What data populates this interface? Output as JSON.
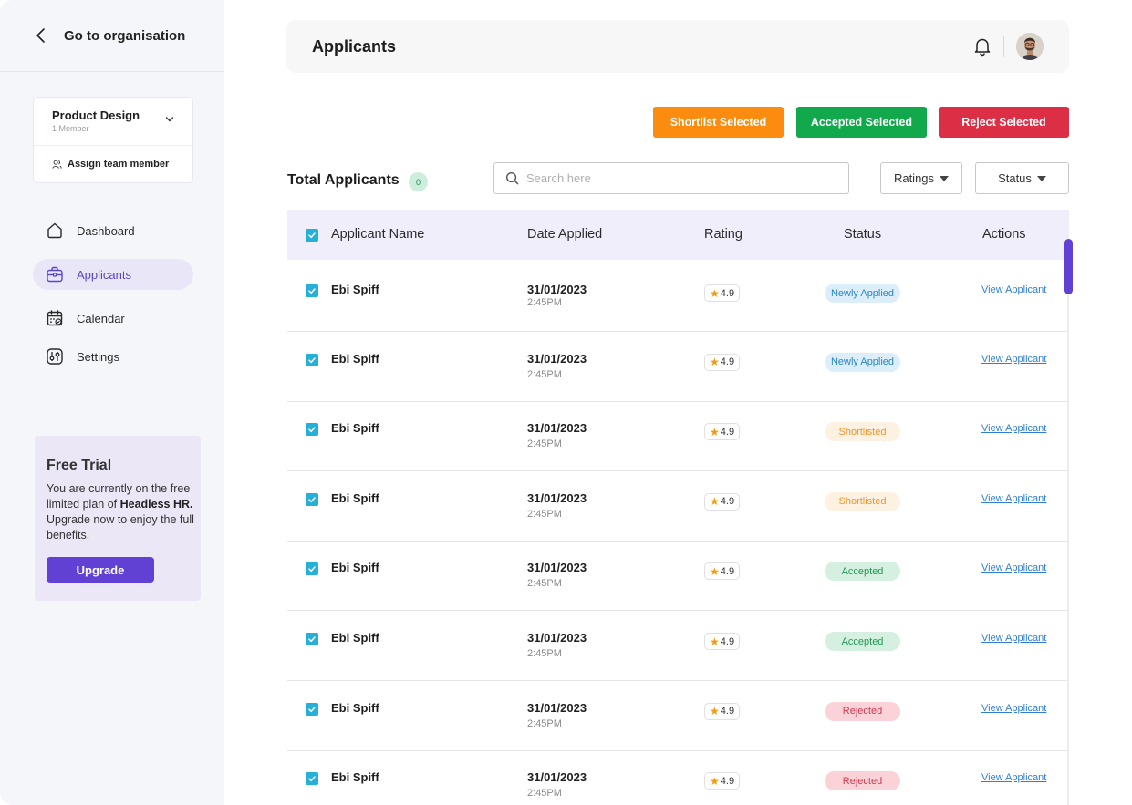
{
  "sidebar": {
    "back_label": "Go to organisation",
    "team": {
      "name": "Product Design",
      "members": "1 Member",
      "assign_label": "Assign team member"
    },
    "nav": [
      {
        "label": "Dashboard",
        "icon": "home-icon",
        "active": false
      },
      {
        "label": "Applicants",
        "icon": "briefcase-icon",
        "active": true
      },
      {
        "label": "Calendar",
        "icon": "calendar-icon",
        "active": false
      },
      {
        "label": "Settings",
        "icon": "settings-icon",
        "active": false
      }
    ],
    "trial": {
      "title": "Free Trial",
      "text_before": "You are currently on the free limited plan of ",
      "brand": "Headless HR.",
      "text_after": " Upgrade now to enjoy the full benefits.",
      "button": "Upgrade"
    }
  },
  "header": {
    "title": "Applicants"
  },
  "actions": {
    "shortlist": "Shortlist Selected",
    "accept": "Accepted Selected",
    "reject": "Reject Selected"
  },
  "toolbar": {
    "total_label": "Total Applicants",
    "total_count": "0",
    "search_placeholder": "Search here",
    "ratings_label": "Ratings",
    "status_label": "Status"
  },
  "table": {
    "columns": [
      "Applicant Name",
      "Date Applied",
      "Rating",
      "Status",
      "Actions"
    ],
    "rows": [
      {
        "name": "Ebi Spiff",
        "date": "31/01/2023",
        "time": "2:45PM",
        "rating": "4.9",
        "status": "Newly Applied",
        "status_type": "newly",
        "action": "View Applicant"
      },
      {
        "name": "Ebi Spiff",
        "date": "31/01/2023",
        "time": "2:45PM",
        "rating": "4.9",
        "status": "Newly Applied",
        "status_type": "newly",
        "action": "View Applicant"
      },
      {
        "name": "Ebi Spiff",
        "date": "31/01/2023",
        "time": "2:45PM",
        "rating": "4.9",
        "status": "Shortlisted",
        "status_type": "short",
        "action": "View Applicant"
      },
      {
        "name": "Ebi Spiff",
        "date": "31/01/2023",
        "time": "2:45PM",
        "rating": "4.9",
        "status": "Shortlisted",
        "status_type": "short",
        "action": "View Applicant"
      },
      {
        "name": "Ebi Spiff",
        "date": "31/01/2023",
        "time": "2:45PM",
        "rating": "4.9",
        "status": "Accepted",
        "status_type": "accept",
        "action": "View Applicant"
      },
      {
        "name": "Ebi Spiff",
        "date": "31/01/2023",
        "time": "2:45PM",
        "rating": "4.9",
        "status": "Accepted",
        "status_type": "accept",
        "action": "View Applicant"
      },
      {
        "name": "Ebi Spiff",
        "date": "31/01/2023",
        "time": "2:45PM",
        "rating": "4.9",
        "status": "Rejected",
        "status_type": "reject",
        "action": "View Applicant"
      },
      {
        "name": "Ebi Spiff",
        "date": "31/01/2023",
        "time": "2:45PM",
        "rating": "4.9",
        "status": "Rejected",
        "status_type": "reject",
        "action": "View Applicant"
      }
    ]
  },
  "colors": {
    "accent": "#6141d4",
    "shortlist": "#fb8c0f",
    "accept": "#11a94c",
    "reject": "#dc2e45",
    "checkbox": "#26b0d8"
  }
}
